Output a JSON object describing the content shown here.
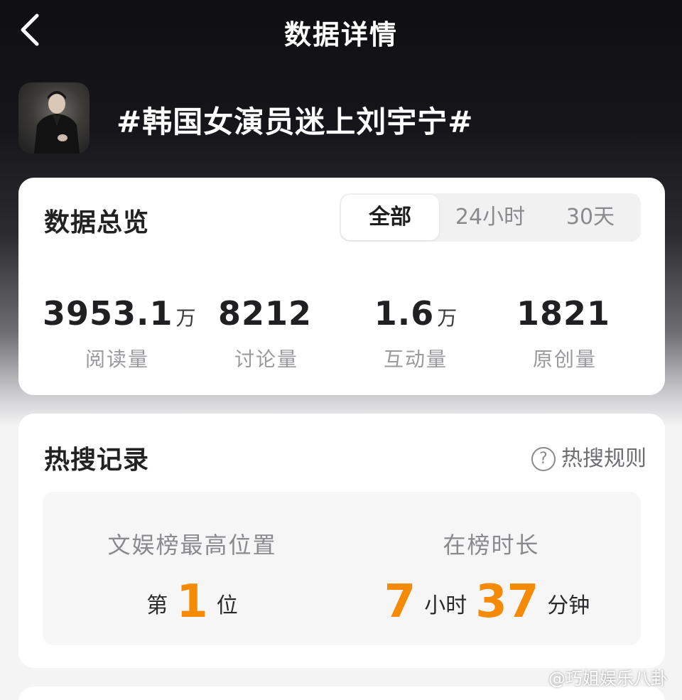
{
  "nav": {
    "title": "数据详情"
  },
  "topic": {
    "title": "#韩国女演员迷上刘宇宁#"
  },
  "overview": {
    "title": "数据总览",
    "tabs": [
      "全部",
      "24小时",
      "30天"
    ],
    "active_tab": "全部",
    "stats": [
      {
        "value": "3953.1",
        "unit": "万",
        "label": "阅读量"
      },
      {
        "value": "8212",
        "unit": "",
        "label": "讨论量"
      },
      {
        "value": "1.6",
        "unit": "万",
        "label": "互动量"
      },
      {
        "value": "1821",
        "unit": "",
        "label": "原创量"
      }
    ]
  },
  "hot_search": {
    "title": "热搜记录",
    "rules_label": "热搜规则",
    "peak": {
      "label": "文娱榜最高位置",
      "prefix": "第",
      "rank": "1",
      "suffix": "位"
    },
    "duration": {
      "label": "在榜时长",
      "hours": "7",
      "hours_unit": "小时",
      "minutes": "37",
      "minutes_unit": "分钟"
    }
  },
  "watermark": "@巧姐娱乐八卦",
  "colors": {
    "accent_orange": "#f58a07",
    "header_dark": "#0f0f11",
    "card_bg": "#ffffff"
  },
  "icons": {
    "back": "chevron-left-icon",
    "help": "question-circle-icon"
  }
}
